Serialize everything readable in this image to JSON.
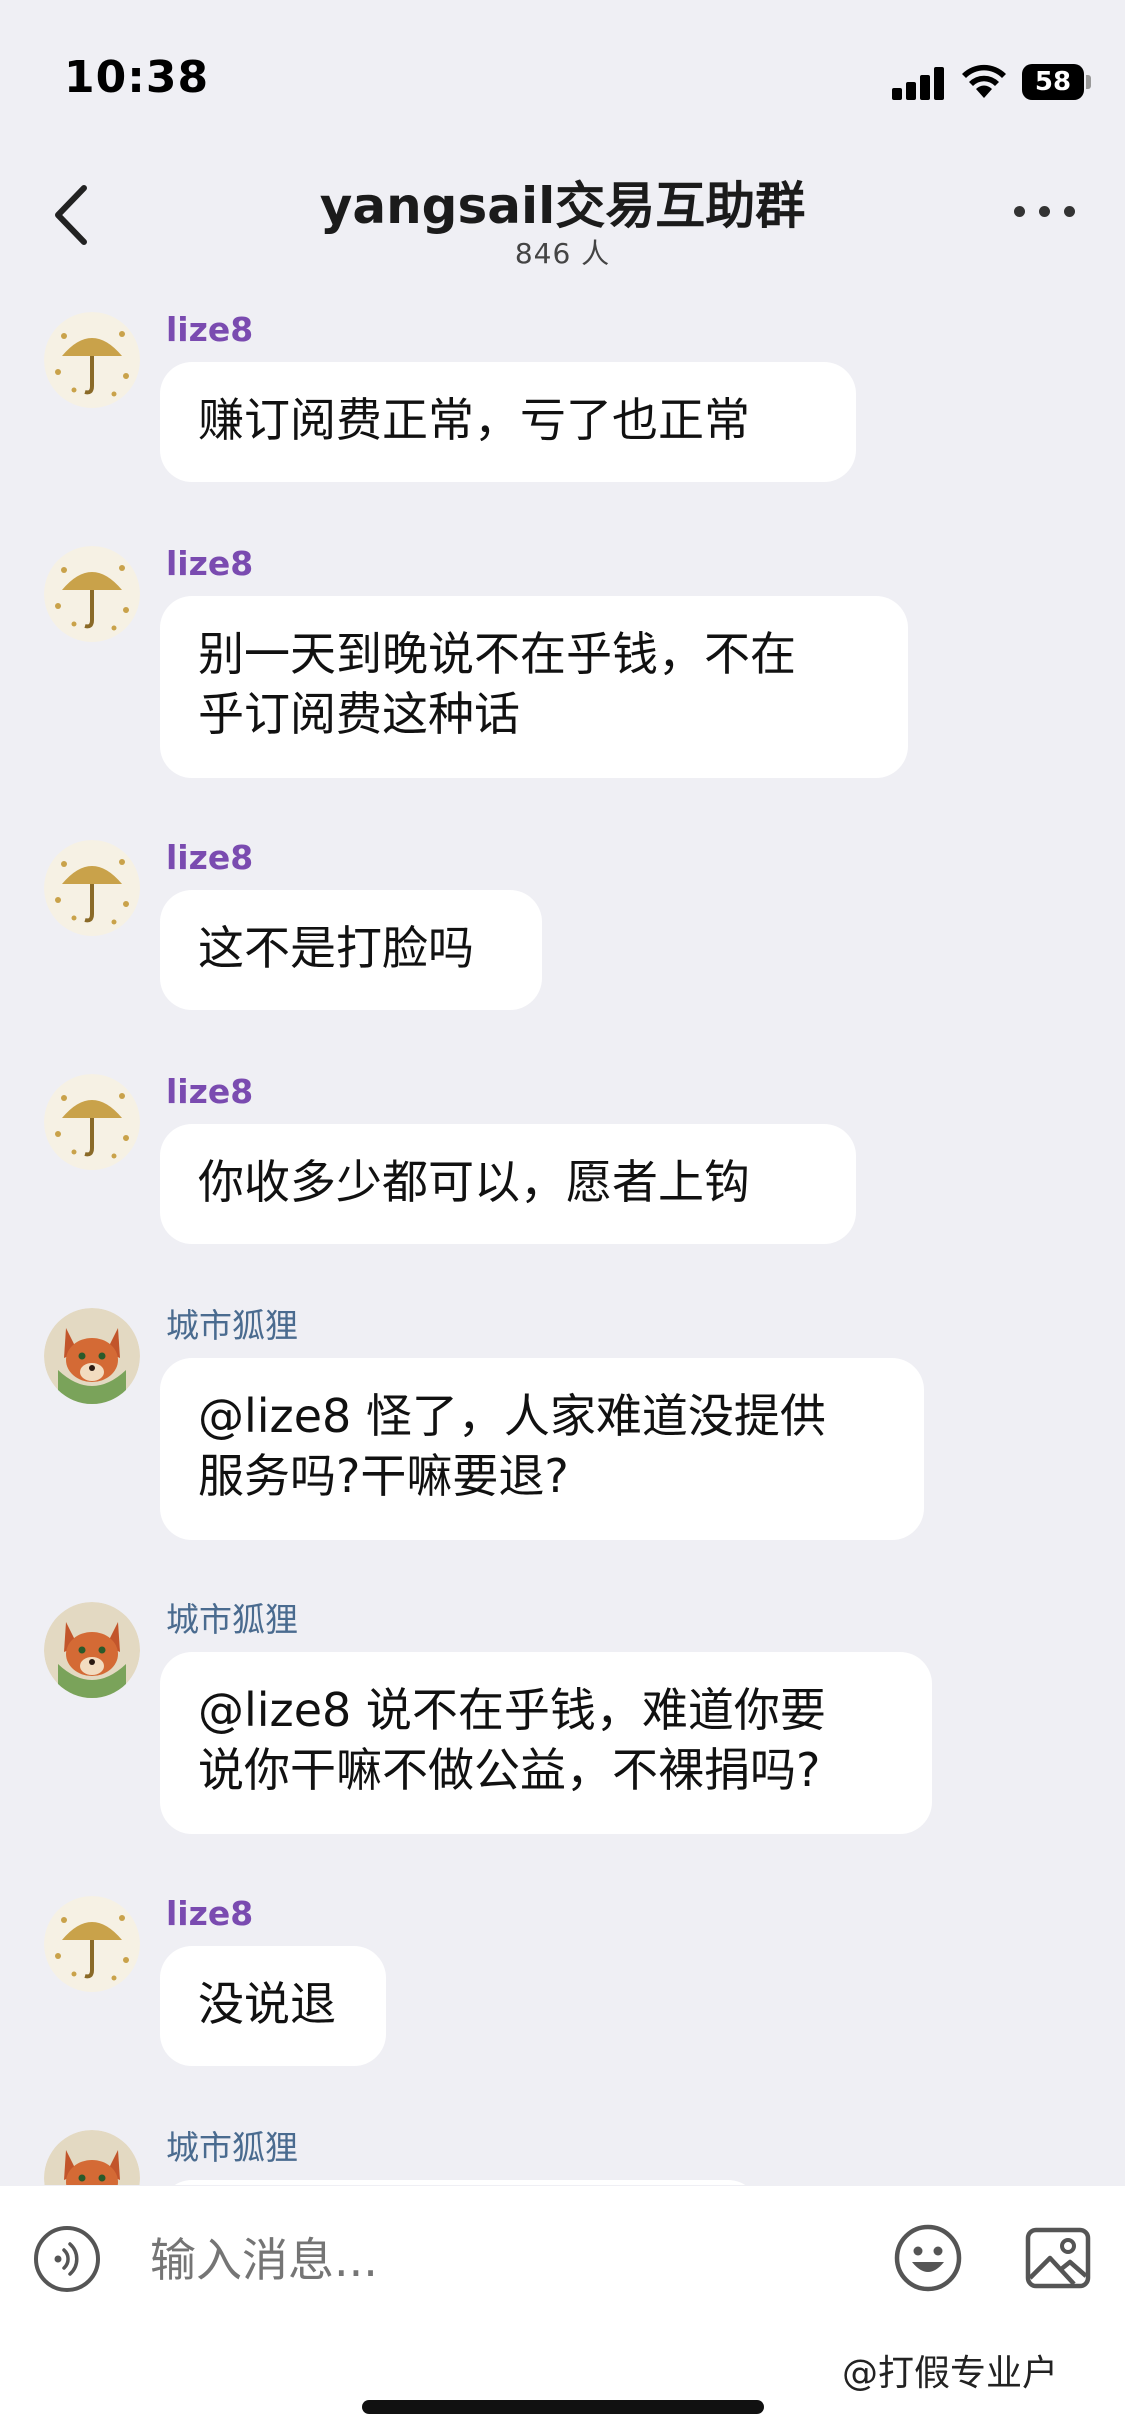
{
  "status_bar": {
    "time": "10:38",
    "battery": "58"
  },
  "header": {
    "back_icon": "chevron-left-icon",
    "title": "yangsail交易互助群",
    "member_count": "846 人",
    "more_icon": "more-horizontal-icon"
  },
  "messages": [
    {
      "sender": "lize8",
      "avatar": "umbrella-avatar",
      "lines": [
        "赚订阅费正常，亏了也正常"
      ]
    },
    {
      "sender": "lize8",
      "avatar": "umbrella-avatar",
      "lines": [
        "别一天到晚说不在乎钱，不在",
        "乎订阅费这种话"
      ]
    },
    {
      "sender": "lize8",
      "avatar": "umbrella-avatar",
      "lines": [
        "这不是打脸吗"
      ]
    },
    {
      "sender": "lize8",
      "avatar": "umbrella-avatar",
      "lines": [
        "你收多少都可以，愿者上钩"
      ]
    },
    {
      "sender": "城市狐狸",
      "avatar": "fox-avatar",
      "lines": [
        "@lize8 怪了，人家难道没提供",
        "服务吗?干嘛要退?"
      ]
    },
    {
      "sender": "城市狐狸",
      "avatar": "fox-avatar",
      "lines": [
        "@lize8 说不在乎钱，难道你要",
        "说你干嘛不做公益，不裸捐吗?"
      ]
    },
    {
      "sender": "lize8",
      "avatar": "umbrella-avatar",
      "lines": [
        "没说退"
      ]
    },
    {
      "sender": "城市狐狸",
      "avatar": "fox-avatar",
      "lines": []
    }
  ],
  "input_bar": {
    "placeholder": "输入消息...",
    "voice_icon": "voice-icon",
    "emoji_icon": "emoji-icon",
    "image_icon": "image-icon",
    "watermark": "@打假专业户"
  },
  "colors": {
    "background": "#efeff4",
    "bubble": "#ffffff",
    "lize_name": "#7a4bb0",
    "fox_name": "#4a6b8f"
  }
}
